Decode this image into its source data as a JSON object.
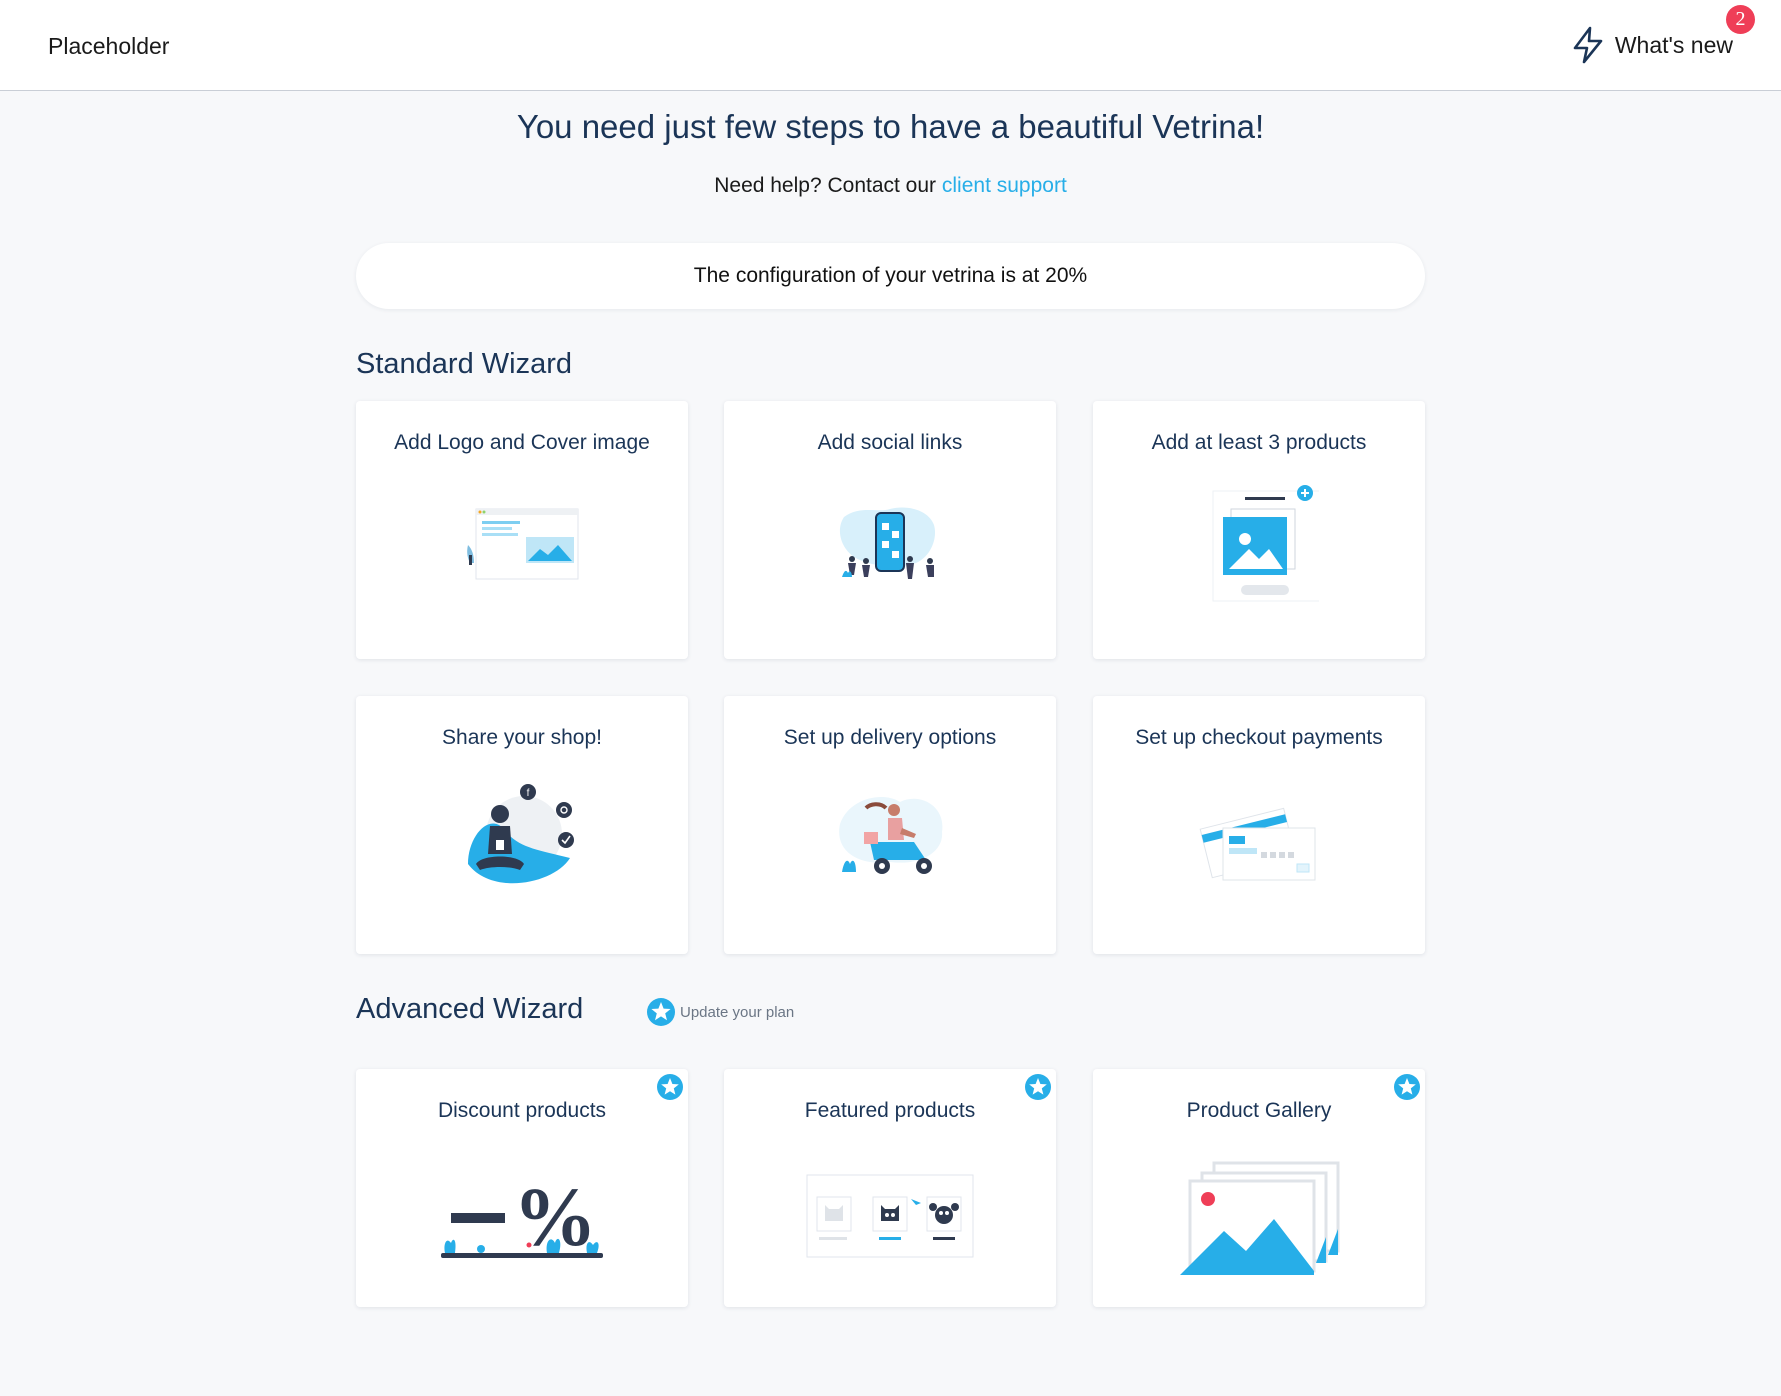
{
  "header": {
    "brand": "Placeholder",
    "whats_new_label": "What's new",
    "notification_count": "2"
  },
  "intro": {
    "headline": "You need just few steps to have a beautiful Vetrina!",
    "help_prefix": "Need help? Contact our ",
    "help_link": "client support"
  },
  "progress": {
    "text": "The configuration of your vetrina is at 20%",
    "percent": 20
  },
  "standard": {
    "title": "Standard Wizard",
    "cards": [
      {
        "title": "Add Logo and Cover image",
        "icon": "logo-cover-illustration"
      },
      {
        "title": "Add social links",
        "icon": "social-links-illustration"
      },
      {
        "title": "Add at least 3 products",
        "icon": "add-products-illustration"
      },
      {
        "title": "Share your shop!",
        "icon": "share-shop-illustration"
      },
      {
        "title": "Set up delivery options",
        "icon": "delivery-illustration"
      },
      {
        "title": "Set up checkout payments",
        "icon": "payments-illustration"
      }
    ]
  },
  "advanced": {
    "title": "Advanced Wizard",
    "upgrade_label": "Update your plan",
    "cards": [
      {
        "title": "Discount products",
        "icon": "discount-illustration"
      },
      {
        "title": "Featured products",
        "icon": "featured-products-illustration"
      },
      {
        "title": "Product Gallery",
        "icon": "gallery-illustration"
      }
    ]
  },
  "colors": {
    "accent": "#27aee8",
    "navy": "#1b3557",
    "badge": "#ef3e57",
    "background": "#f7f8fa"
  }
}
